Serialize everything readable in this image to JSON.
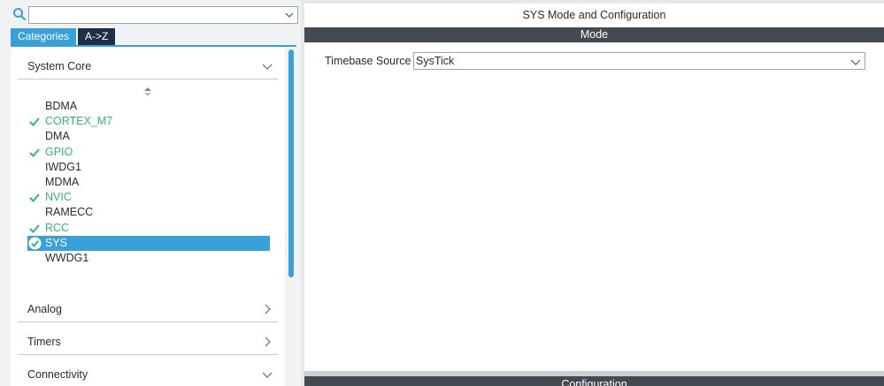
{
  "search": {
    "value": "",
    "placeholder": ""
  },
  "tabs": [
    {
      "label": "Categories",
      "active": true
    },
    {
      "label": "A->Z",
      "active": false
    }
  ],
  "categories": [
    {
      "label": "System Core",
      "expanded": true
    },
    {
      "label": "Analog",
      "expanded": false
    },
    {
      "label": "Timers",
      "expanded": false
    },
    {
      "label": "Connectivity",
      "expanded": true
    }
  ],
  "system_core_items": [
    {
      "label": "BDMA",
      "status": "none"
    },
    {
      "label": "CORTEX_M7",
      "status": "ok"
    },
    {
      "label": "DMA",
      "status": "none"
    },
    {
      "label": "GPIO",
      "status": "ok"
    },
    {
      "label": "IWDG1",
      "status": "none"
    },
    {
      "label": "MDMA",
      "status": "none"
    },
    {
      "label": "NVIC",
      "status": "ok"
    },
    {
      "label": "RAMECC",
      "status": "none"
    },
    {
      "label": "RCC",
      "status": "ok"
    },
    {
      "label": "SYS",
      "status": "selected"
    },
    {
      "label": "WWDG1",
      "status": "none"
    }
  ],
  "panel": {
    "title": "SYS Mode and Configuration",
    "mode_header": "Mode",
    "timebase_label": "Timebase Source",
    "timebase_value": "SysTick",
    "config_header": "Configuration"
  },
  "colors": {
    "accent": "#3aa0d8",
    "ok": "#36b37e",
    "dark_bar": "#434a50",
    "tab_dark": "#1d2f44"
  }
}
